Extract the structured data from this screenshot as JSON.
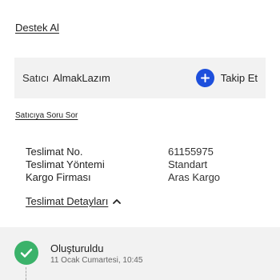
{
  "support": {
    "link_label": "Destek Al"
  },
  "seller": {
    "prefix": "Satıcı",
    "name": "AlmakLazım",
    "follow_label": "Takip Et",
    "follow_icon": "plus-icon",
    "accent": "#1d4fdc"
  },
  "ask_seller": {
    "link_label": "Satıcıya Soru Sor"
  },
  "shipping": {
    "rows": [
      {
        "label": "Teslimat No.",
        "value": "61155975"
      },
      {
        "label": "Teslimat Yöntemi",
        "value": "Standart"
      },
      {
        "label": "Kargo Firması",
        "value": "Aras Kargo"
      }
    ],
    "details_toggle": "Teslimat Detayları",
    "details_icon": "chevron-up-icon"
  },
  "status": {
    "title": "Oluşturuldu",
    "date": "11 Ocak Cumartesi, 10:45",
    "icon": "check-icon",
    "color": "#3bb26a"
  }
}
